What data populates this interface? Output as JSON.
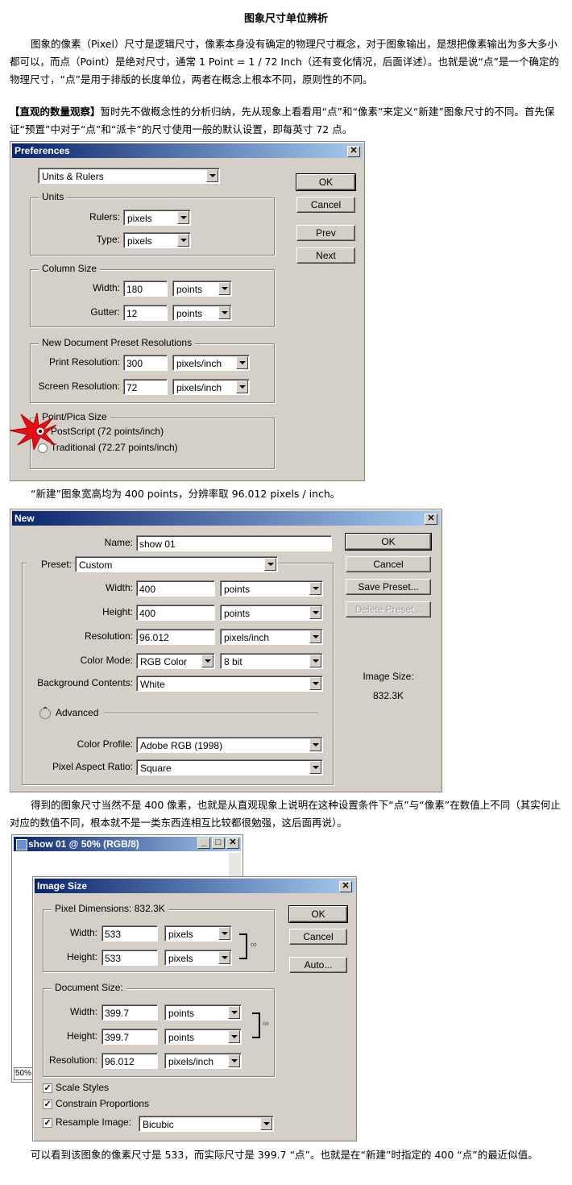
{
  "doc": {
    "title": "图象尺寸单位辨析",
    "para1": "图象的像素（Pixel）尺寸是逻辑尺寸，像素本身没有确定的物理尺寸概念，对于图象输出，是想把像素输出为多大多小都可以，而点（Point）是绝对尺寸，通常 1 Point = 1 / 72 Inch（还有变化情况，后面详述）。也就是说“点”是一个确定的物理尺寸，“点”是用于排版的长度单位，两者在概念上根本不同，原则性的不同。",
    "para2_bold": "【直观的数量观察】",
    "para2": "暂时先不做概念性的分析归纳，先从现象上看看用“点”和“像素”来定义“新建”图象尺寸的不同。首先保证“预置”中对于“点”和“派卡”的尺寸使用一般的默认设置，即每英寸 72 点。",
    "para3": "“新建”图象宽高均为 400 points，分辨率取 96.012 pixels / inch。",
    "para4": "得到的图象尺寸当然不是 400 像素，也就是从直观现象上说明在这种设置条件下“点”与“像素”在数值上不同（其实何止对应的数值不同，根本就不是一类东西连相互比较都很勉强，这后面再说）。",
    "para5": "可以看到该图象的像素尺寸是 533，而实际尺寸是 399.7 “点”。也就是在“新建”时指定的 400 “点”的最近似值。"
  },
  "prefs": {
    "title": "Preferences",
    "section": "Units & Rulers",
    "units_group": "Units",
    "rulers_label": "Rulers:",
    "rulers_value": "pixels",
    "type_label": "Type:",
    "type_value": "pixels",
    "column_group": "Column Size",
    "width_label": "Width:",
    "width_value": "180",
    "width_unit": "points",
    "gutter_label": "Gutter:",
    "gutter_value": "12",
    "gutter_unit": "points",
    "preset_group": "New Document Preset Resolutions",
    "print_label": "Print Resolution:",
    "print_value": "300",
    "print_unit": "pixels/inch",
    "screen_label": "Screen Resolution:",
    "screen_value": "72",
    "screen_unit": "pixels/inch",
    "pica_group": "Point/Pica Size",
    "postscript": "PostScript (72 points/inch)",
    "traditional": "Traditional (72.27 points/inch)",
    "ok": "OK",
    "cancel": "Cancel",
    "prev": "Prev",
    "next": "Next"
  },
  "newdlg": {
    "title": "New",
    "name_label": "Name:",
    "name_value": "show 01",
    "preset_label": "Preset:",
    "preset_value": "Custom",
    "width_label": "Width:",
    "width_value": "400",
    "width_unit": "points",
    "height_label": "Height:",
    "height_value": "400",
    "height_unit": "points",
    "res_label": "Resolution:",
    "res_value": "96.012",
    "res_unit": "pixels/inch",
    "mode_label": "Color Mode:",
    "mode_value": "RGB Color",
    "mode_bits": "8 bit",
    "bg_label": "Background Contents:",
    "bg_value": "White",
    "advanced": "Advanced",
    "profile_label": "Color Profile:",
    "profile_value": "Adobe RGB (1998)",
    "aspect_label": "Pixel Aspect Ratio:",
    "aspect_value": "Square",
    "ok": "OK",
    "cancel": "Cancel",
    "save_preset": "Save Preset...",
    "delete_preset": "Delete Preset...",
    "size_label": "Image Size:",
    "size_value": "832.3K"
  },
  "docwin": {
    "title": "show 01 @ 50% (RGB/8)",
    "zoom": "50%"
  },
  "imgsize": {
    "title": "Image Size",
    "pixel_group": "Pixel Dimensions:",
    "pixel_size": "832.3K",
    "pw_label": "Width:",
    "pw_value": "533",
    "pw_unit": "pixels",
    "ph_label": "Height:",
    "ph_value": "533",
    "ph_unit": "pixels",
    "doc_group": "Document Size:",
    "dw_label": "Width:",
    "dw_value": "399.7",
    "dw_unit": "points",
    "dh_label": "Height:",
    "dh_value": "399.7",
    "dh_unit": "points",
    "res_label": "Resolution:",
    "res_value": "96.012",
    "res_unit": "pixels/inch",
    "scale_styles": "Scale Styles",
    "constrain": "Constrain Proportions",
    "resample_label": "Resample Image:",
    "resample_value": "Bicubic",
    "ok": "OK",
    "cancel": "Cancel",
    "auto": "Auto..."
  }
}
